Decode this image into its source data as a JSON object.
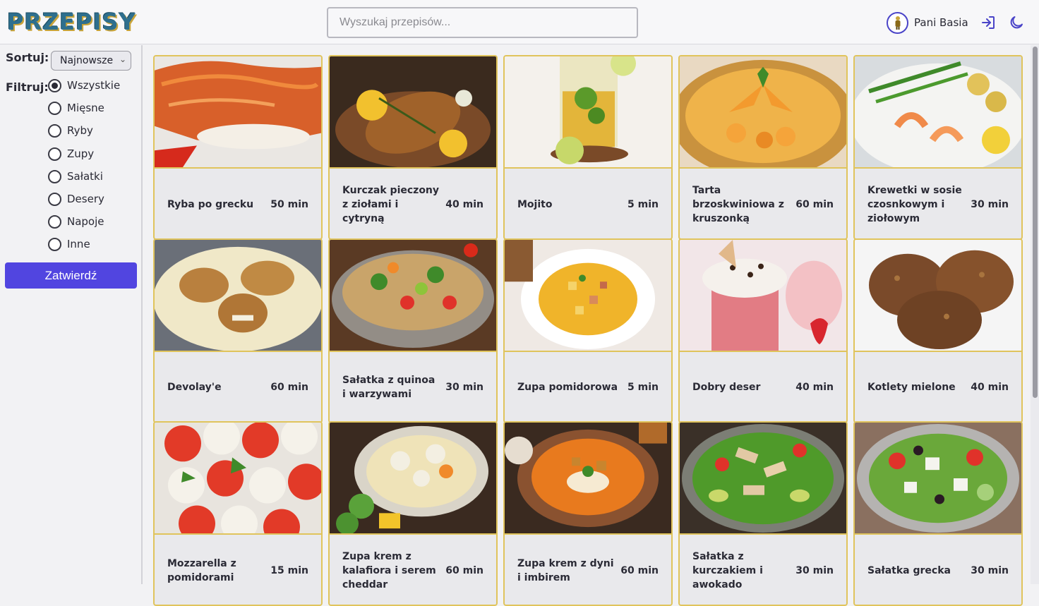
{
  "app": {
    "logo": "PRZEPISY"
  },
  "search": {
    "placeholder": "Wyszukaj przepisów..."
  },
  "user": {
    "name": "Pani Basia"
  },
  "sidebar": {
    "sort_label": "Sortuj:",
    "sort_value": "Najnowsze",
    "filter_label": "Filtruj:",
    "filters": [
      {
        "label": "Wszystkie",
        "selected": true
      },
      {
        "label": "Mięsne",
        "selected": false
      },
      {
        "label": "Ryby",
        "selected": false
      },
      {
        "label": "Zupy",
        "selected": false
      },
      {
        "label": "Sałatki",
        "selected": false
      },
      {
        "label": "Desery",
        "selected": false
      },
      {
        "label": "Napoje",
        "selected": false
      },
      {
        "label": "Inne",
        "selected": false
      }
    ],
    "submit_label": "Zatwierdź"
  },
  "recipes": [
    {
      "title": "Ryba po grecku",
      "time": "50 min",
      "icon": "fish-carrot-image"
    },
    {
      "title": "Kurczak pieczony z ziołami i cytryną",
      "time": "40 min",
      "icon": "roast-chicken-image"
    },
    {
      "title": "Mojito",
      "time": "5 min",
      "icon": "mojito-image"
    },
    {
      "title": "Tarta brzoskwiniowa z kruszonką",
      "time": "60 min",
      "icon": "peach-tart-image"
    },
    {
      "title": "Krewetki w sosie czosnkowym i ziołowym",
      "time": "30 min",
      "icon": "shrimp-image"
    },
    {
      "title": "Devolay'e",
      "time": "60 min",
      "icon": "breaded-chicken-image"
    },
    {
      "title": "Sałatka z quinoa i warzywami",
      "time": "30 min",
      "icon": "quinoa-salad-image"
    },
    {
      "title": "Zupa pomidorowa",
      "time": "5 min",
      "icon": "soup-image"
    },
    {
      "title": "Dobry deser",
      "time": "40 min",
      "icon": "dessert-image"
    },
    {
      "title": "Kotlety mielone",
      "time": "40 min",
      "icon": "patties-image"
    },
    {
      "title": "Mozzarella z pomidorami",
      "time": "15 min",
      "icon": "caprese-image"
    },
    {
      "title": "Zupa krem z kalafiora i serem cheddar",
      "time": "60 min",
      "icon": "cauliflower-soup-image"
    },
    {
      "title": "Zupa krem z dyni i imbirem",
      "time": "60 min",
      "icon": "pumpkin-soup-image"
    },
    {
      "title": "Sałatka z kurczakiem i awokado",
      "time": "30 min",
      "icon": "chicken-avocado-salad-image"
    },
    {
      "title": "Sałatka grecka",
      "time": "30 min",
      "icon": "greek-salad-image"
    }
  ]
}
